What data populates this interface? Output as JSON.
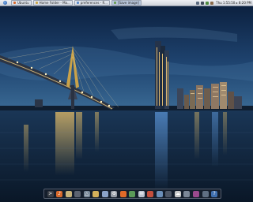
{
  "top_panel": {
    "app_menu_icon": "blue-orb-icon",
    "tasks": [
      {
        "label": "Ubuntu",
        "icon": "firefox-icon",
        "color": "#d9672a",
        "active": false
      },
      {
        "label": "Home Folder - Ma...",
        "icon": "folder-icon",
        "color": "#c8a54b",
        "active": false
      },
      {
        "label": "preferences - R...",
        "icon": "text-editor-icon",
        "color": "#5a8acb",
        "active": false
      },
      {
        "label": "[Save image]",
        "icon": "image-icon",
        "color": "#6a9c4f",
        "active": true
      }
    ],
    "tray_icons": [
      "network-icon",
      "volume-icon",
      "battery-icon",
      "user-icon"
    ],
    "clock": "Thu 1:55:50 ▸ 8:20 PM"
  },
  "wallpaper": {
    "subject": "night-bridge-city-skyline",
    "sky_top": "#0c2140",
    "sky_horizon": "#2e5a86",
    "water": "#11253d"
  },
  "dock": {
    "items": [
      {
        "name": "terminal-icon",
        "color": "#3a3f47",
        "glyph": ">"
      },
      {
        "name": "music-player-icon",
        "color": "#d86a2c",
        "glyph": "♪"
      },
      {
        "name": "files-icon",
        "color": "#c8b37a",
        "glyph": ""
      },
      {
        "name": "trash-icon",
        "color": "#5c6370",
        "glyph": ""
      },
      {
        "name": "triangle-app-icon",
        "color": "#7a8a9a",
        "glyph": "△"
      },
      {
        "name": "folder-icon",
        "color": "#d3b05a",
        "glyph": ""
      },
      {
        "name": "image-viewer-icon",
        "color": "#8aa3c9",
        "glyph": ""
      },
      {
        "name": "settings-icon",
        "color": "#9aa0a8",
        "glyph": "⚙"
      },
      {
        "name": "firefox-icon",
        "color": "#e06a28",
        "glyph": ""
      },
      {
        "name": "chat-icon",
        "color": "#5a9a58",
        "glyph": ""
      },
      {
        "name": "mail-icon",
        "color": "#b9c2cf",
        "glyph": "✉"
      },
      {
        "name": "calendar-icon",
        "color": "#c44f3d",
        "glyph": ""
      },
      {
        "name": "globe-icon",
        "color": "#6b8fb8",
        "glyph": ""
      },
      {
        "name": "window-icon",
        "color": "#4d5665",
        "glyph": ""
      },
      {
        "name": "weather-icon",
        "color": "#c9c9c9",
        "glyph": "☁"
      },
      {
        "name": "display-icon",
        "color": "#7b8797",
        "glyph": ""
      },
      {
        "name": "video-icon",
        "color": "#9b4a8d",
        "glyph": ""
      },
      {
        "name": "network-icon",
        "color": "#5f6f83",
        "glyph": ""
      },
      {
        "name": "help-icon",
        "color": "#3f6fae",
        "glyph": "?"
      }
    ]
  }
}
